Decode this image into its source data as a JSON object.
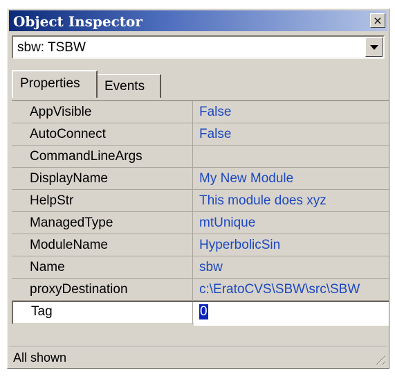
{
  "window": {
    "title": "Object Inspector",
    "close_glyph": "×"
  },
  "selector": {
    "value": "sbw: TSBW"
  },
  "tabs": [
    {
      "label": "Properties"
    },
    {
      "label": "Events"
    }
  ],
  "properties": [
    {
      "name": "AppVisible",
      "value": "False"
    },
    {
      "name": "AutoConnect",
      "value": "False"
    },
    {
      "name": "CommandLineArgs",
      "value": ""
    },
    {
      "name": "DisplayName",
      "value": "My New Module"
    },
    {
      "name": "HelpStr",
      "value": "This module does xyz"
    },
    {
      "name": "ManagedType",
      "value": "mtUnique"
    },
    {
      "name": "ModuleName",
      "value": "HyperbolicSin"
    },
    {
      "name": "Name",
      "value": "sbw"
    },
    {
      "name": "proxyDestination",
      "value": "c:\\EratoCVS\\SBW\\src\\SBW"
    },
    {
      "name": "Tag",
      "value": "0"
    }
  ],
  "status": {
    "text": "All shown"
  },
  "colors": {
    "title_start": "#0c2a78",
    "title_end": "#b4c4e6",
    "value_text": "#1c48c0",
    "selection": "#0a24b8"
  }
}
